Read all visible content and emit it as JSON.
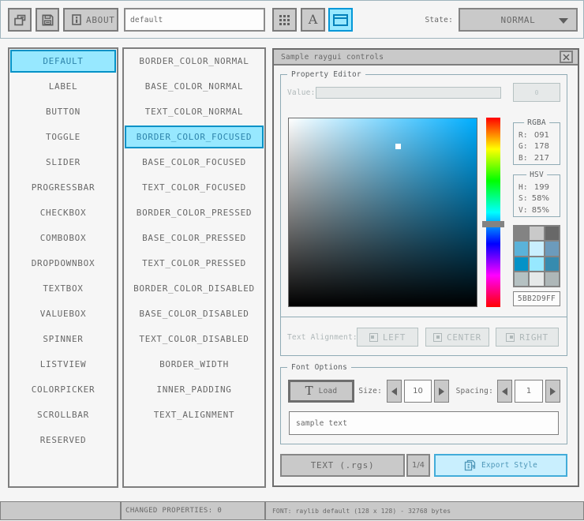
{
  "toolbar": {
    "file_name_value": "default",
    "about_label": "ABOUT",
    "state_label": "State:",
    "state_value": "NORMAL"
  },
  "controls": {
    "items": [
      "DEFAULT",
      "LABEL",
      "BUTTON",
      "TOGGLE",
      "SLIDER",
      "PROGRESSBAR",
      "CHECKBOX",
      "COMBOBOX",
      "DROPDOWNBOX",
      "TEXTBOX",
      "VALUEBOX",
      "SPINNER",
      "LISTVIEW",
      "COLORPICKER",
      "SCROLLBAR",
      "RESERVED"
    ],
    "selected": "DEFAULT"
  },
  "properties": {
    "items": [
      "BORDER_COLOR_NORMAL",
      "BASE_COLOR_NORMAL",
      "TEXT_COLOR_NORMAL",
      "BORDER_COLOR_FOCUSED",
      "BASE_COLOR_FOCUSED",
      "TEXT_COLOR_FOCUSED",
      "BORDER_COLOR_PRESSED",
      "BASE_COLOR_PRESSED",
      "TEXT_COLOR_PRESSED",
      "BORDER_COLOR_DISABLED",
      "BASE_COLOR_DISABLED",
      "TEXT_COLOR_DISABLED",
      "BORDER_WIDTH",
      "INNER_PADDING",
      "TEXT_ALIGNMENT"
    ],
    "selected": "BORDER_COLOR_FOCUSED"
  },
  "window": {
    "title": "Sample raygui controls",
    "property_editor": {
      "label": "Property Editor",
      "value_label": "Value:",
      "value_text": "",
      "value_button": "0",
      "rgba": {
        "label": "RGBA",
        "rows": [
          {
            "k": "R:",
            "v": "091"
          },
          {
            "k": "G:",
            "v": "178"
          },
          {
            "k": "B:",
            "v": "217"
          }
        ]
      },
      "hsv": {
        "label": "HSV",
        "rows": [
          {
            "k": "H:",
            "v": "199"
          },
          {
            "k": "S:",
            "v": "58%"
          },
          {
            "k": "V:",
            "v": "85%"
          }
        ]
      },
      "hex_value": "5BB2D9FF",
      "palette": [
        "#838383",
        "#c9c9c9",
        "#686868",
        "#5bb2d9",
        "#c9effe",
        "#6c9bbc",
        "#0492c7",
        "#97e8ff",
        "#368baf",
        "#b5c1c2",
        "#e6e9e9",
        "#aeb7b8"
      ],
      "picker": {
        "hue": 199,
        "saturation": "58%",
        "value": "85%",
        "selected_color": "#5bb2d9"
      },
      "text_alignment_label": "Text Alignment:",
      "align_left": "LEFT",
      "align_center": "CENTER",
      "align_right": "RIGHT"
    },
    "font_options": {
      "label": "Font Options",
      "load_label": "Load",
      "size_label": "Size:",
      "size_value": "10",
      "spacing_label": "Spacing:",
      "spacing_value": "1",
      "sample_text": "sample text"
    },
    "export": {
      "text_format_button": "TEXT (.rgs)",
      "page_indicator": "1/4",
      "export_button": "Export Style"
    }
  },
  "status_bar": {
    "changed_properties": "CHANGED PROPERTIES: 0",
    "font_info": "FONT: raylib default (128 x 128) - 32768 bytes"
  }
}
